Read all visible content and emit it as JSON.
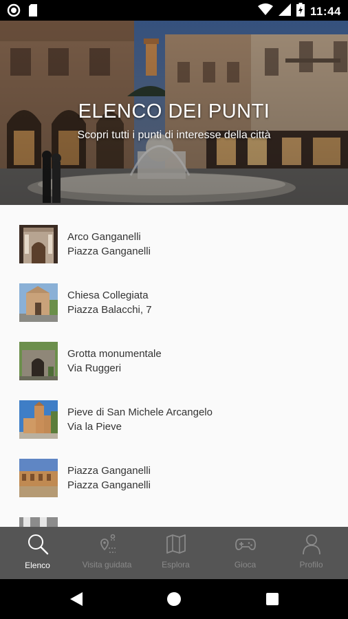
{
  "status_bar": {
    "time": "11:44"
  },
  "hero": {
    "title": "ELENCO DEI PUNTI",
    "subtitle": "Scopri tutti i punti di interesse della città"
  },
  "points": [
    {
      "title": "Arco Ganganelli",
      "address": "Piazza Ganganelli"
    },
    {
      "title": "Chiesa Collegiata",
      "address": "Piazza Balacchi, 7"
    },
    {
      "title": "Grotta monumentale",
      "address": "Via Ruggeri"
    },
    {
      "title": "Pieve di San Michele Arcangelo",
      "address": "Via la Pieve"
    },
    {
      "title": "Piazza Ganganelli",
      "address": "Piazza Ganganelli"
    }
  ],
  "bottom_nav": {
    "tabs": [
      {
        "label": "Elenco",
        "icon": "search-icon",
        "active": true
      },
      {
        "label": "Visita guidata",
        "icon": "route-icon",
        "active": false
      },
      {
        "label": "Esplora",
        "icon": "map-icon",
        "active": false
      },
      {
        "label": "Gioca",
        "icon": "gamepad-icon",
        "active": false
      },
      {
        "label": "Profilo",
        "icon": "person-icon",
        "active": false
      }
    ]
  },
  "colors": {
    "status_bar": "#000000",
    "bottom_nav_bg": "#555555",
    "active_tab": "#ffffff",
    "inactive_tab": "#8a8a8a",
    "list_bg": "#fafafa"
  }
}
